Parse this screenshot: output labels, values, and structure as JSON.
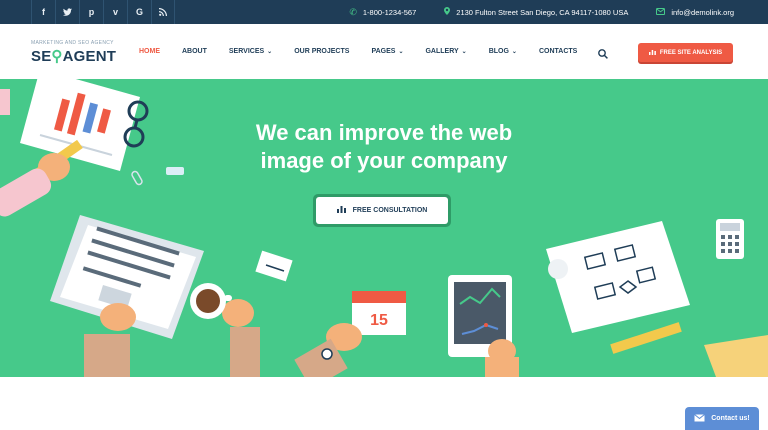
{
  "topbar": {
    "social": [
      {
        "icon": "facebook-icon",
        "glyph": "f"
      },
      {
        "icon": "twitter-icon",
        "glyph": "t"
      },
      {
        "icon": "pinterest-icon",
        "glyph": "p"
      },
      {
        "icon": "vimeo-icon",
        "glyph": "v"
      },
      {
        "icon": "google-icon",
        "glyph": "G"
      },
      {
        "icon": "rss-icon",
        "glyph": "r"
      }
    ],
    "phone": "1-800-1234-567",
    "address": "2130 Fulton Street San Diego, CA 94117-1080 USA",
    "email": "info@demolink.org"
  },
  "brand": {
    "tagline": "MARKETING AND SEO AGENCY",
    "name_part1": "SE",
    "name_part2": "AGENT"
  },
  "nav": {
    "items": [
      {
        "label": "HOME",
        "dropdown": false
      },
      {
        "label": "ABOUT",
        "dropdown": false
      },
      {
        "label": "SERVICES",
        "dropdown": true
      },
      {
        "label": "OUR PROJECTS",
        "dropdown": false
      },
      {
        "label": "PAGES",
        "dropdown": true
      },
      {
        "label": "GALLERY",
        "dropdown": true
      },
      {
        "label": "BLOG",
        "dropdown": true
      },
      {
        "label": "CONTACTS",
        "dropdown": false
      }
    ],
    "cta_label": "FREE SITE ANALYSIS"
  },
  "hero": {
    "headline_line1": "We can improve the web",
    "headline_line2": "image of your company",
    "button_label": "FREE CONSULTATION",
    "calendar_day": "15"
  },
  "widget": {
    "contact_label": "Contact us!"
  },
  "colors": {
    "topbar": "#1f3d57",
    "accent_green": "#46c98a",
    "accent_red": "#ef5a44",
    "widget_blue": "#5d8ed6"
  }
}
